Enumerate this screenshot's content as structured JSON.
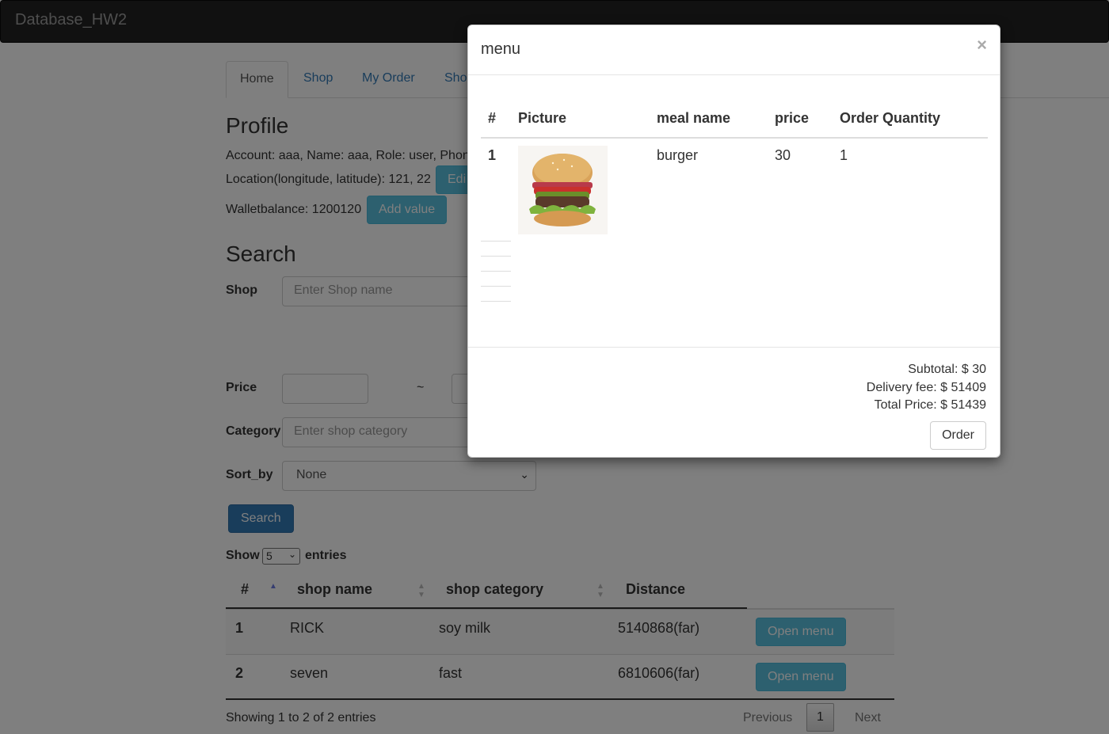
{
  "navbar": {
    "brand": "Database_HW2"
  },
  "tabs": [
    {
      "label": "Home",
      "active": true
    },
    {
      "label": "Shop"
    },
    {
      "label": "My Order"
    },
    {
      "label": "Sho"
    }
  ],
  "profile": {
    "title": "Profile",
    "account_line": "Account: aaa, Name: aaa, Role: user, Phone",
    "location_line": "Location(longitude, latitude): 121, 22",
    "edit_label": "Edi",
    "wallet_line": "Walletbalance: 1200120",
    "add_value_label": "Add value"
  },
  "search": {
    "title": "Search",
    "shop_label": "Shop",
    "shop_placeholder": "Enter Shop name",
    "price_label": "Price",
    "price_sep": "~",
    "category_label": "Category",
    "category_placeholder": "Enter shop category",
    "sort_label": "Sort_by",
    "sort_value": "None",
    "search_button": "Search"
  },
  "table": {
    "show_label": "Show",
    "entries_value": "5",
    "entries_label": "entries",
    "headers": [
      "#",
      "shop name",
      "shop category",
      "Distance"
    ],
    "rows": [
      {
        "no": "1",
        "name": "RICK",
        "category": "soy milk",
        "distance": "5140868(far)",
        "action": "Open menu"
      },
      {
        "no": "2",
        "name": "seven",
        "category": "fast",
        "distance": "6810606(far)",
        "action": "Open menu"
      }
    ],
    "info": "Showing 1 to 2 of 2 entries",
    "prev": "Previous",
    "page": "1",
    "next": "Next"
  },
  "modal": {
    "title": "menu",
    "close": "×",
    "headers": [
      "#",
      "Picture",
      "meal name",
      "price",
      "Order Quantity"
    ],
    "items": [
      {
        "no": "1",
        "picture": "burger-image",
        "meal": "burger",
        "price": "30",
        "qty": "1"
      }
    ],
    "subtotal": "Subtotal: $ 30",
    "delivery": "Delivery fee: $ 51409",
    "total": "Total Price: $ 51439",
    "order_button": "Order"
  },
  "colors": {
    "info": "#5bc0de",
    "primary": "#337ab7",
    "navbar": "#222222"
  }
}
